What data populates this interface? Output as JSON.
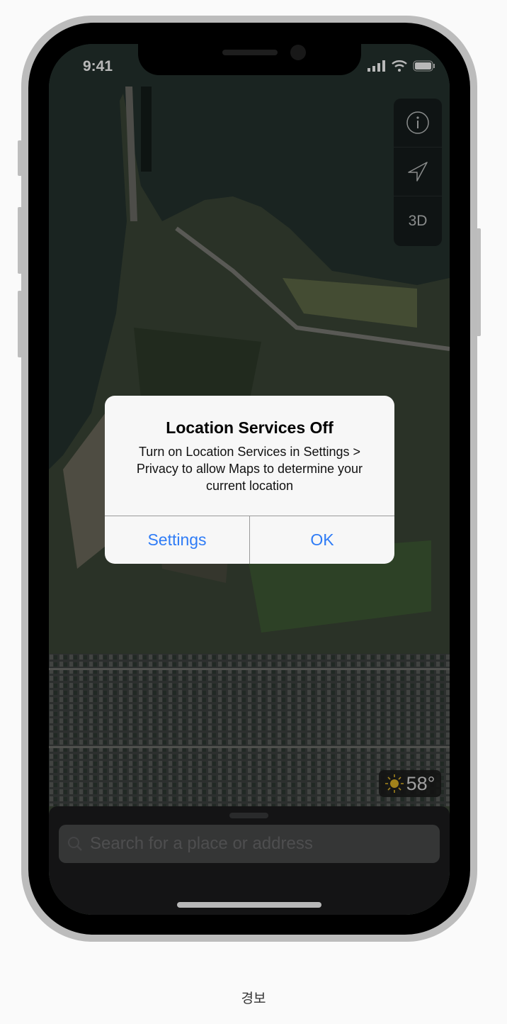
{
  "status_bar": {
    "time": "9:41"
  },
  "map_controls": {
    "info_icon": "info-icon",
    "location_icon": "location-arrow-icon",
    "mode_label": "3D"
  },
  "weather": {
    "icon": "sun-icon",
    "temperature": "58°",
    "icon_color": "#e0b526"
  },
  "search": {
    "placeholder": "Search for a place or address"
  },
  "alert": {
    "title": "Location Services Off",
    "message": "Turn on Location Services in Settings > Privacy to allow Maps to determine your current location",
    "buttons": [
      "Settings",
      "OK"
    ],
    "accent": "#2f7cf6"
  },
  "caption": "경보"
}
